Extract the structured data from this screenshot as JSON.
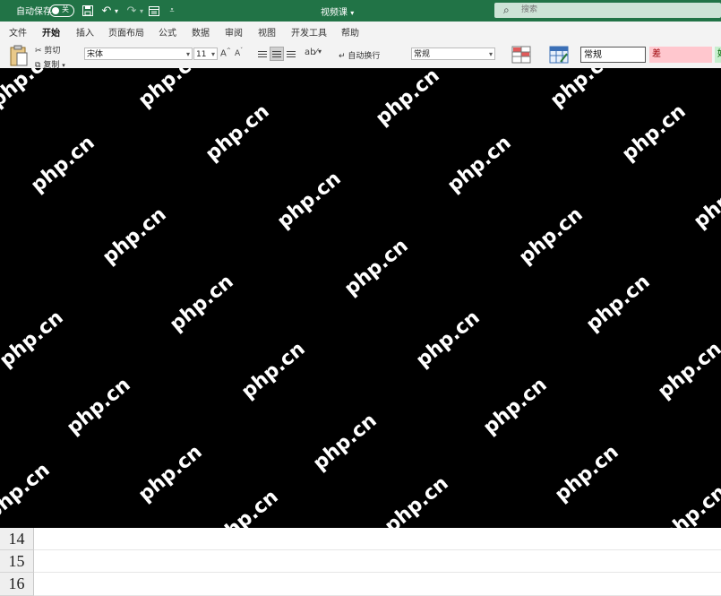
{
  "titlebar": {
    "autosave_label": "自动保存",
    "autosave_state": "关",
    "doc_title": "视频课",
    "doc_title_caret": "▾",
    "search_placeholder": "搜索",
    "bg_color": "#217346"
  },
  "tabs": [
    "文件",
    "开始",
    "插入",
    "页面布局",
    "公式",
    "数据",
    "审阅",
    "视图",
    "开发工具",
    "帮助"
  ],
  "active_tab": "开始",
  "ribbon": {
    "cut_label": "剪切",
    "copy_label": "复制",
    "font_name": "宋体",
    "font_size": "11",
    "wrap_text_label": "自动换行",
    "number_format": "常规",
    "style_normal": "常规",
    "style_bad": "差",
    "style_good_partial": "好"
  },
  "overlay": {
    "watermark_text": "php.cn",
    "bg_color": "#000000"
  },
  "rows": [
    "14",
    "15",
    "16"
  ]
}
